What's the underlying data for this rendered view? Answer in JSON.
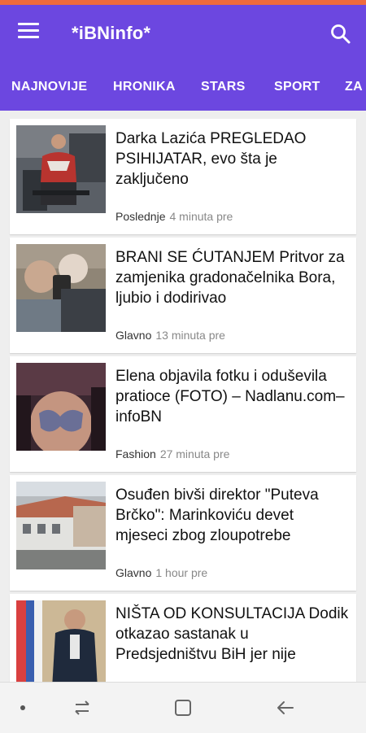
{
  "app": {
    "title": "*iBNinfo*"
  },
  "colors": {
    "accent": "#6c47e0",
    "top_strip": "#ef6a3c"
  },
  "tabs": [
    {
      "label": "NAJNOVIJE"
    },
    {
      "label": "HRONIKA"
    },
    {
      "label": "STARS"
    },
    {
      "label": "SPORT"
    },
    {
      "label": "ZA"
    }
  ],
  "articles": [
    {
      "headline": "Darka Lazića PREGLEDAO PSIHIJATAR, evo šta je zaključeno",
      "category": "Poslednje",
      "time": "4 minuta pre",
      "thumb": "man-in-chair-photo"
    },
    {
      "headline": "BRANI SE ĆUTANJEM Pritvor za zamjenika gradonačelnika Bora, ljubio i dodirivao",
      "category": "Glavno",
      "time": "13 minuta pre",
      "thumb": "selfie-photo"
    },
    {
      "headline": "Elena objavila fotku i oduševila pratioce (FOTO) – Nadlanu.com–infoBN",
      "category": "Fashion",
      "time": "27 minuta pre",
      "thumb": "woman-photo"
    },
    {
      "headline": "Osuđen bivši direktor \"Puteva Brčko\": Marinkoviću devet mjeseci zbog zloupotrebe",
      "category": "Glavno",
      "time": "1 hour pre",
      "thumb": "building-photo"
    },
    {
      "headline": "NIŠTA OD KONSULTACIJA Dodik otkazao sastanak u Predsjedništvu BiH jer nije",
      "category": "",
      "time": "",
      "thumb": "politician-flag-photo"
    }
  ],
  "icons": {
    "menu": "menu-icon",
    "search": "search-icon",
    "nav_recents": "recents-icon",
    "nav_home": "home-icon",
    "nav_back": "back-icon"
  }
}
